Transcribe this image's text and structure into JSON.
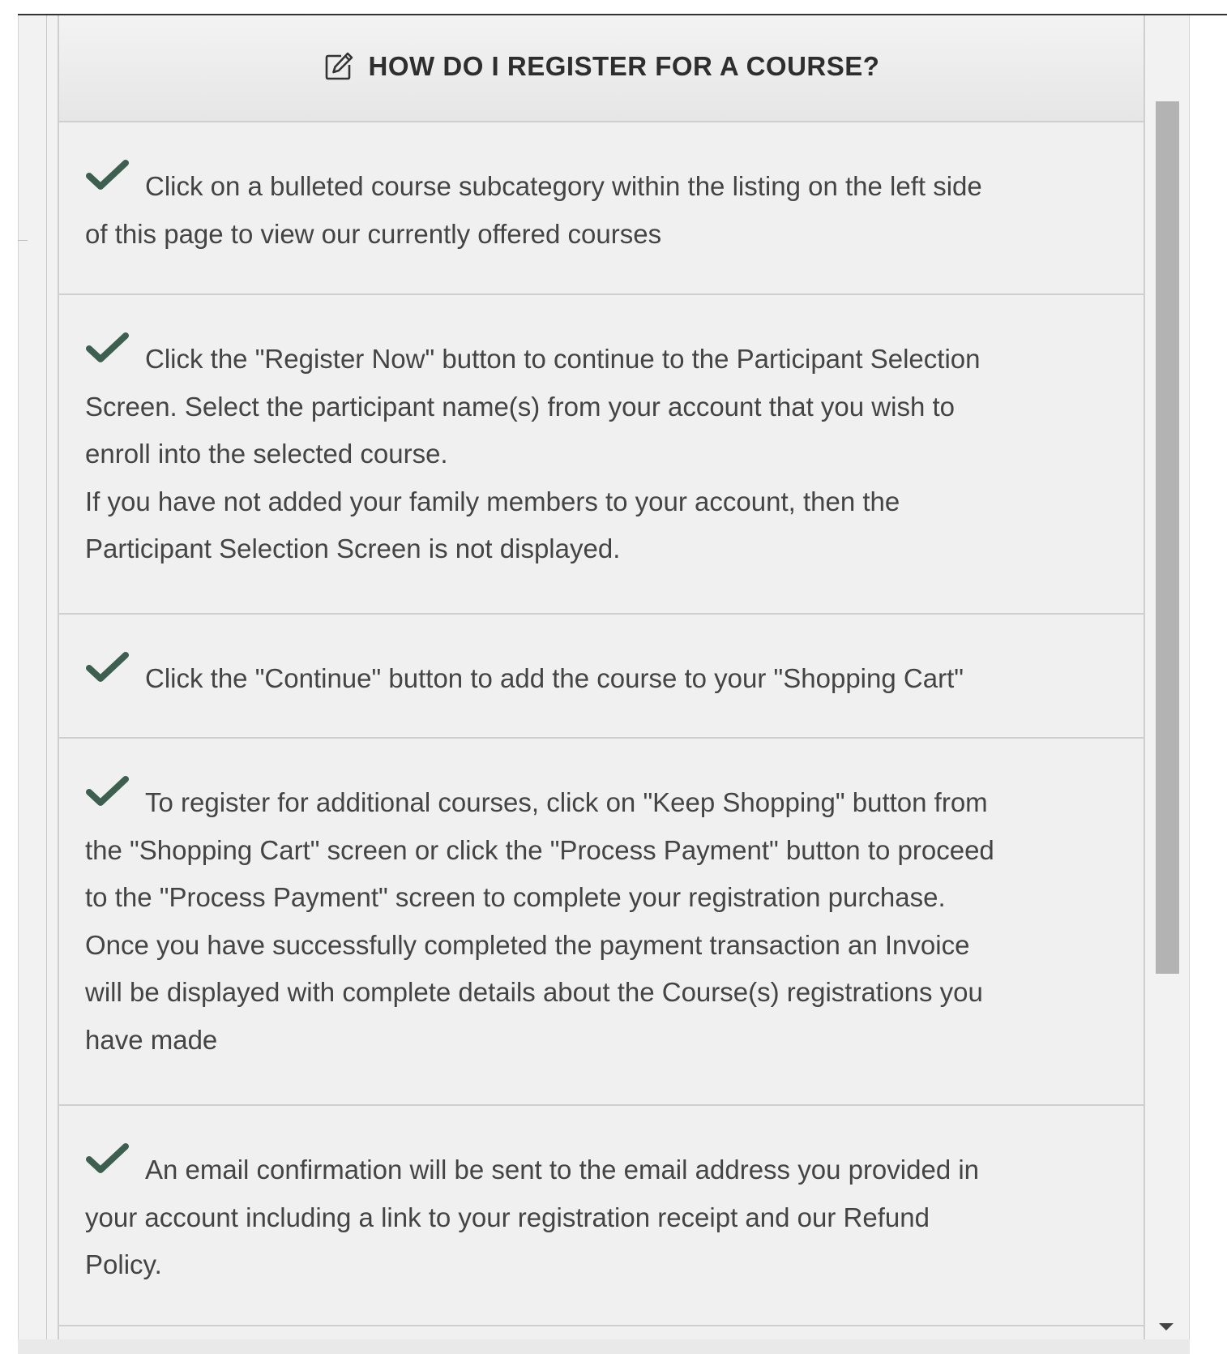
{
  "panel": {
    "title": "HOW DO I REGISTER FOR A COURSE?",
    "icons": {
      "header": "edit-icon",
      "step": "check-icon"
    },
    "colors": {
      "check": "#3c5f4f",
      "text": "#444444",
      "title": "#2e2e2e"
    }
  },
  "steps": [
    {
      "lines": [
        "Click on a bulleted course subcategory within the listing on the left side",
        "of this page to view our currently offered courses"
      ]
    },
    {
      "lines": [
        "Click the \"Register Now\" button to continue to the Participant Selection",
        "Screen. Select the participant name(s) from your account that you wish to",
        "enroll into the selected course.",
        "If you have not added your family members to your account, then the",
        "Participant Selection Screen is not displayed."
      ]
    },
    {
      "lines": [
        "Click the \"Continue\" button to add the course to your \"Shopping Cart\""
      ]
    },
    {
      "lines": [
        "To register for additional courses, click on \"Keep Shopping\" button from",
        "the \"Shopping Cart\" screen or click the \"Process Payment\" button to proceed",
        "to the \"Process Payment\" screen to complete your registration purchase.",
        "Once you have successfully completed the payment transaction an Invoice",
        "will be displayed with complete details about the Course(s) registrations you",
        "have made"
      ]
    },
    {
      "lines": [
        "An email confirmation will be sent to the email address you provided in",
        "your account including a link to your registration receipt and our Refund",
        "Policy."
      ]
    }
  ]
}
